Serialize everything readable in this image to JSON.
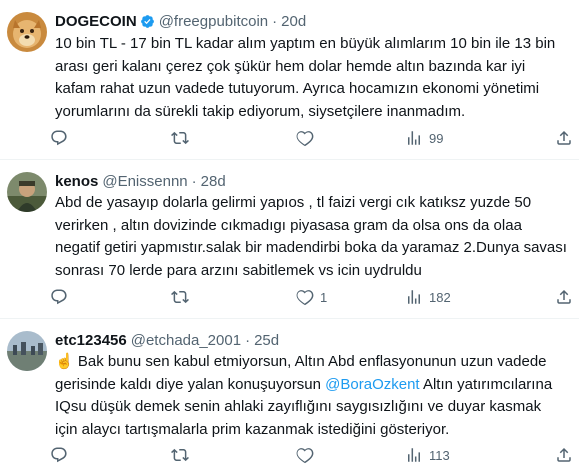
{
  "tweets": [
    {
      "name": "DOGECOIN",
      "verified_icon": "verified-badge-icon",
      "handle": "@freegpubitcoin",
      "dot": "·",
      "time": "20d",
      "text": "10 bin TL - 17 bin TL kadar alım yaptım en büyük alımlarım 10 bin ile 13 bin arası geri kalanı çerez çok şükür hem dolar hemde altın bazında kar iyi kafam rahat uzun vadede tutuyorum. Ayrıca hocamızın ekonomi yönetimi yorumlarını da sürekli takip ediyorum, siysetçilere inanmadım.",
      "actions": {
        "replies": "",
        "retweets": "",
        "likes": "",
        "views": "99"
      }
    },
    {
      "name": "kenos",
      "handle": "@Enissennn",
      "dot": "·",
      "time": "28d",
      "text": "Abd de yasayıp dolarla gelirmi yapıos , tl faizi vergi cık katıksz yuzde 50 verirken , altın dovizinde cıkmadıgı piyasasa gram da olsa ons da olaa negatif getiri yapmıstır.salak bir madendirbi boka da yaramaz 2.Dunya savası sonrası 70 lerde para arzını sabitlemek vs icin uydruldu",
      "actions": {
        "replies": "",
        "retweets": "",
        "likes": "1",
        "views": "182"
      }
    },
    {
      "name": "etc123456",
      "handle": "@etchada_2001",
      "dot": "·",
      "time": "25d",
      "emoji": "☝️",
      "text_before": " Bak bunu sen kabul etmiyorsun, Altın Abd enflasyonunun uzun vadede gerisinde kaldı diye yalan konuşuyorsun ",
      "mention": "@BoraOzkent",
      "text_after": " Altın yatırımcılarına IQsu düşük demek senin ahlaki  zayıflığını saygısızlığını ve duyar kasmak için alaycı tartışmalarla prim kazanmak istediğini gösteriyor.",
      "actions": {
        "replies": "",
        "retweets": "",
        "likes": "",
        "views": "113"
      }
    }
  ],
  "colors": {
    "text": "#0f1419",
    "secondary": "#536471",
    "link": "#1d9bf0",
    "verified": "#1d9bf0",
    "separator": "#eff3f4"
  }
}
